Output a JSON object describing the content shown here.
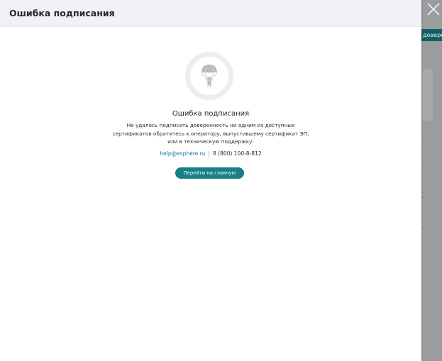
{
  "background": {
    "chip_text": "доверенн"
  },
  "modal": {
    "title": "Ошибка подписания",
    "illustration_icon": "parachute-icon",
    "error_title": "Ошибка подписания",
    "error_message": "Не удалось подписать доверенность ни одним из доступных сертификатов обратитесь  к оператору, выпустившему сертификат ЭП, или в техническую поддержку:",
    "support_email": "help@esphere.ru",
    "separator": "|",
    "support_phone": "8 (800) 100-8-812",
    "primary_button": "Перейти на главную"
  },
  "icons": {
    "close": "close-icon"
  },
  "colors": {
    "accent": "#177f85",
    "link": "#1a76a6",
    "header_bg": "#f1f2f6",
    "overlay": "#9a9c9e"
  }
}
